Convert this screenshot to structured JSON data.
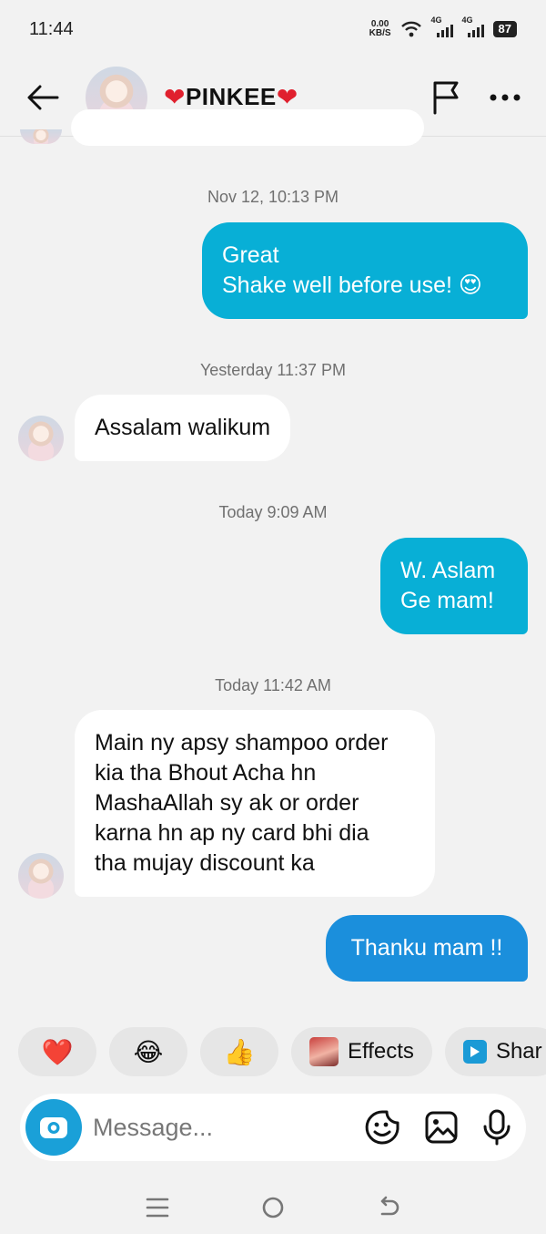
{
  "status_bar": {
    "time": "11:44",
    "net_speed_value": "0.00",
    "net_speed_unit": "KB/S",
    "sim1_label": "4G",
    "sim2_label": "4G",
    "battery": "87"
  },
  "header": {
    "contact_name": "PINKEE",
    "heart_left": "❤",
    "heart_right": "❤"
  },
  "messages": [
    {
      "timestamp": "Nov 12, 10:13 PM"
    },
    {
      "direction": "outgoing",
      "line1": "Great",
      "line2": "Shake well before use! 😍"
    },
    {
      "timestamp": "Yesterday 11:37 PM"
    },
    {
      "direction": "incoming",
      "text": "Assalam walikum"
    },
    {
      "timestamp": "Today 9:09 AM"
    },
    {
      "direction": "outgoing",
      "line1": "W. Aslam",
      "line2": "Ge mam!"
    },
    {
      "timestamp": "Today 11:42 AM"
    },
    {
      "direction": "incoming",
      "line1": "Main ny apsy shampoo order",
      "line2": "kia tha Bhout Acha hn",
      "line3": "MashaAllah sy ak or order",
      "line4": "karna hn ap ny card bhi dia",
      "line5": "tha mujay discount ka"
    },
    {
      "direction": "outgoing",
      "text": "Thanku mam !!"
    }
  ],
  "quick_replies": {
    "heart": "❤️",
    "laugh": "😂",
    "thumbs": "👍",
    "effects_label": "Effects",
    "share_label": "Shar"
  },
  "composer": {
    "placeholder": "Message..."
  },
  "icons": {
    "back": "arrow-left-icon",
    "flag": "flag-icon",
    "more": "more-horizontal-icon",
    "camera": "camera-icon",
    "sticker": "sticker-icon",
    "gallery": "gallery-icon",
    "mic": "microphone-icon"
  },
  "colors": {
    "outgoing_bubble": "#08afd6",
    "outgoing_bubble_last": "#1b8fdc",
    "incoming_bubble": "#ffffff",
    "background": "#f2f2f2",
    "camera_button": "#1aa0d8"
  }
}
